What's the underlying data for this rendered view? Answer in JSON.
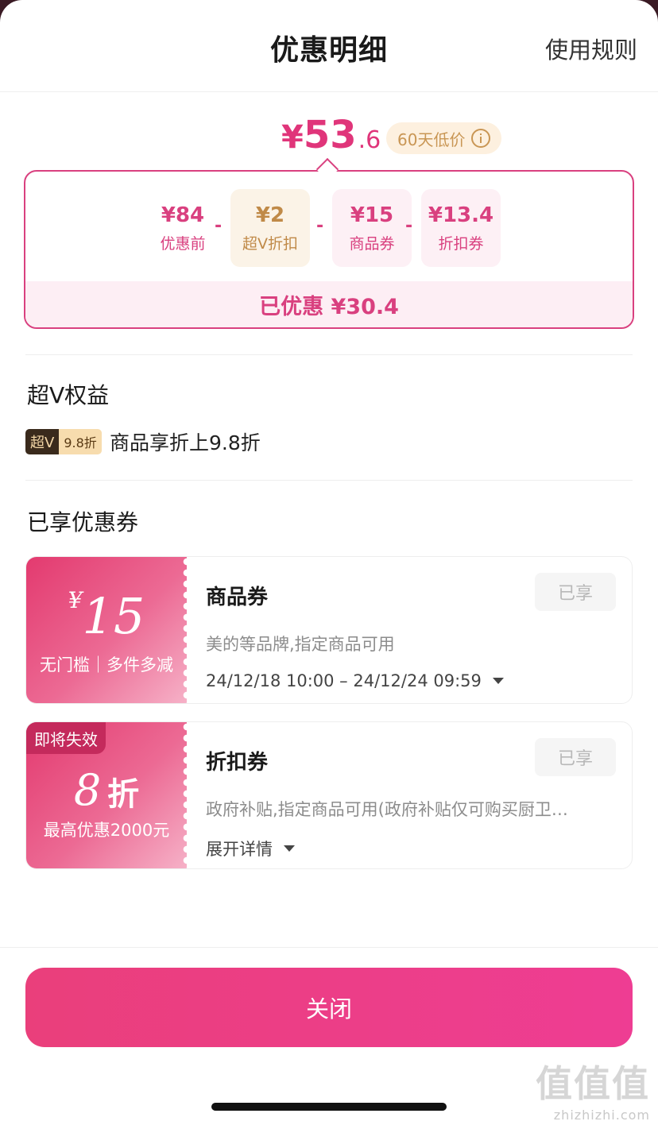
{
  "header": {
    "title": "优惠明细",
    "rules_link": "使用规则"
  },
  "price": {
    "symbol": "¥",
    "integer": "53",
    "decimal": ".6",
    "badge": "60天低价"
  },
  "breakdown": {
    "items": [
      {
        "amount": "¥84",
        "label": "优惠前"
      },
      {
        "amount": "¥2",
        "label": "超V折扣"
      },
      {
        "amount": "¥15",
        "label": "商品券"
      },
      {
        "amount": "¥13.4",
        "label": "折扣券"
      }
    ],
    "operator": "-",
    "saved": "已优惠 ¥30.4"
  },
  "superv": {
    "section_title": "超V权益",
    "tag_left": "超V",
    "tag_right": "9.8折",
    "description": "商品享折上9.8折"
  },
  "coupons_section": {
    "title": "已享优惠券"
  },
  "coupons": [
    {
      "symbol": "¥",
      "value": "15",
      "condition": "无门槛｜多件多减",
      "name": "商品券",
      "status": "已享",
      "description": "美的等品牌,指定商品可用",
      "validity": "24/12/18 10:00 – 24/12/24 09:59"
    },
    {
      "expire_tag": "即将失效",
      "value": "8",
      "unit": "折",
      "condition": "最高优惠2000元",
      "name": "折扣券",
      "status": "已享",
      "description": "政府补贴,指定商品可用(政府补贴仅可购买厨卫…",
      "expand": "展开详情"
    }
  ],
  "footer": {
    "close_label": "关闭"
  },
  "watermark": {
    "main": "值值值",
    "sub": "zhizhizhi.com"
  },
  "colors": {
    "accent": "#e0357a",
    "gold": "#c99654",
    "button": "#ea3f7b"
  }
}
